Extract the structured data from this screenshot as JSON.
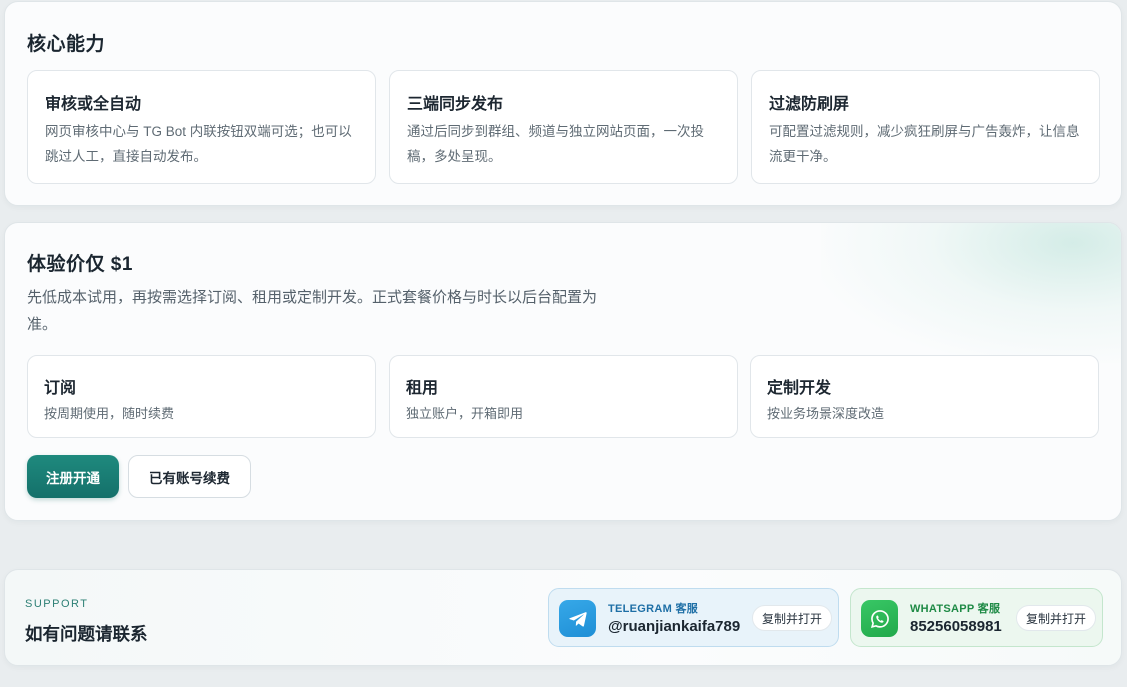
{
  "core": {
    "title": "核心能力",
    "features": [
      {
        "title": "审核或全自动",
        "desc": "网页审核中心与 TG Bot 内联按钮双端可选；也可以跳过人工，直接自动发布。"
      },
      {
        "title": "三端同步发布",
        "desc": "通过后同步到群组、频道与独立网站页面，一次投稿，多处呈现。"
      },
      {
        "title": "过滤防刷屏",
        "desc": "可配置过滤规则，减少疯狂刷屏与广告轰炸，让信息流更干净。"
      }
    ]
  },
  "pricing": {
    "title": "体验价仅 $1",
    "desc": "先低成本试用，再按需选择订阅、租用或定制开发。正式套餐价格与时长以后台配置为准。",
    "plans": [
      {
        "title": "订阅",
        "desc": "按周期使用，随时续费"
      },
      {
        "title": "租用",
        "desc": "独立账户，开箱即用"
      },
      {
        "title": "定制开发",
        "desc": "按业务场景深度改造"
      }
    ],
    "primary_button": "注册开通",
    "secondary_button": "已有账号续费"
  },
  "support": {
    "eyebrow": "SUPPORT",
    "title": "如有问题请联系",
    "contacts": [
      {
        "label": "TELEGRAM 客服",
        "value": "@ruanjiankaifa789",
        "copy_label": "复制并打开",
        "icon": "telegram-icon",
        "color": "#229ED9"
      },
      {
        "label": "WHATSAPP 客服",
        "value": "85256058981",
        "copy_label": "复制并打开",
        "icon": "whatsapp-icon",
        "color": "#25B455"
      }
    ]
  }
}
